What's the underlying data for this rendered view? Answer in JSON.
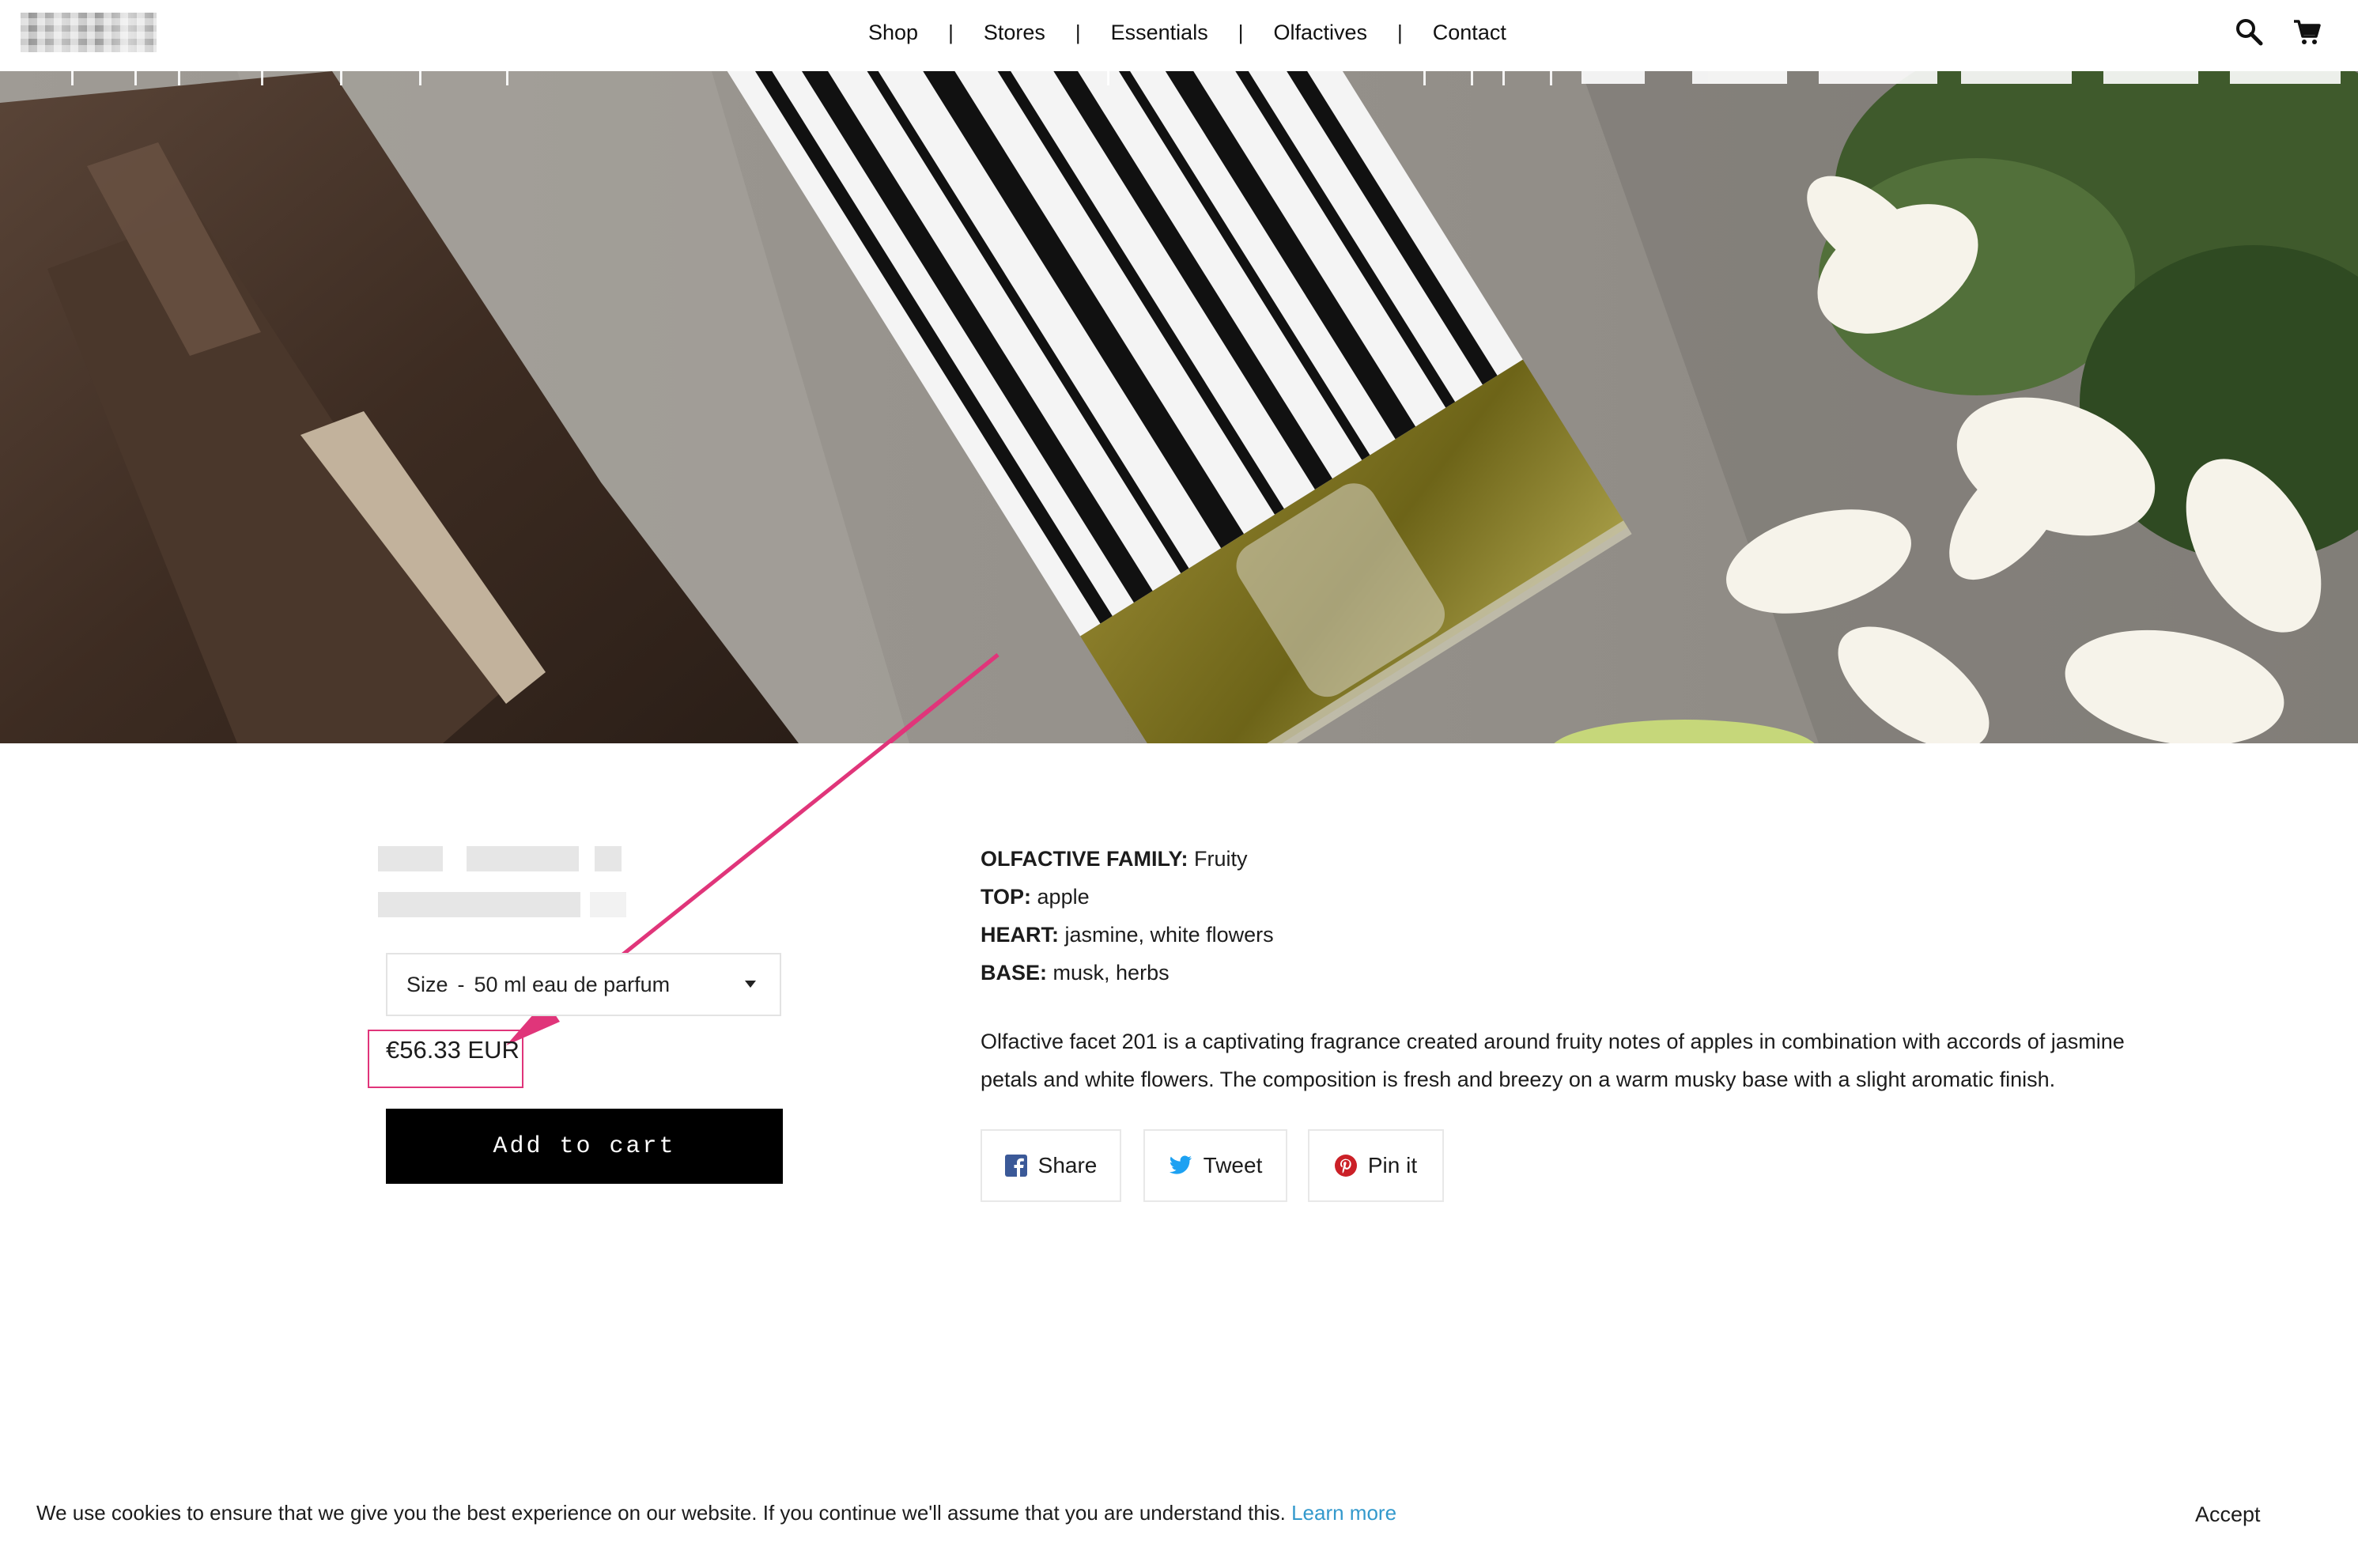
{
  "header": {
    "nav": [
      "Shop",
      "Stores",
      "Essentials",
      "Olfactives",
      "Contact"
    ],
    "separator": "|",
    "icons": {
      "search": "search-icon",
      "cart": "cart-icon"
    }
  },
  "product": {
    "variant": {
      "label": "Size",
      "separator": "-",
      "value": "50 ml eau de parfum"
    },
    "price": "€56.33 EUR",
    "add_to_cart": "Add to cart",
    "notes": [
      {
        "label": "OLFACTIVE FAMILY:",
        "value": "Fruity"
      },
      {
        "label": "TOP:",
        "value": "apple"
      },
      {
        "label": "HEART:",
        "value": "jasmine, white flowers"
      },
      {
        "label": "BASE:",
        "value": "musk, herbs"
      }
    ],
    "description": "Olfactive facet 201 is a captivating fragrance created around fruity notes of apples in combination with accords of jasmine petals and white flowers. The composition is fresh and breezy on a warm musky base with a slight aromatic finish.",
    "share": [
      {
        "label": "Share",
        "icon": "facebook-icon",
        "color": "#3b5998"
      },
      {
        "label": "Tweet",
        "icon": "twitter-icon",
        "color": "#1da1f2"
      },
      {
        "label": "Pin it",
        "icon": "pinterest-icon",
        "color": "#cb2027"
      }
    ]
  },
  "cookie": {
    "text": "We use cookies to ensure that we give you the best experience on our website. If you continue we'll assume that you are understand this.",
    "link": "Learn more",
    "accept": "Accept"
  },
  "colors": {
    "annotation": "#e0357a",
    "link": "#3399cc"
  }
}
